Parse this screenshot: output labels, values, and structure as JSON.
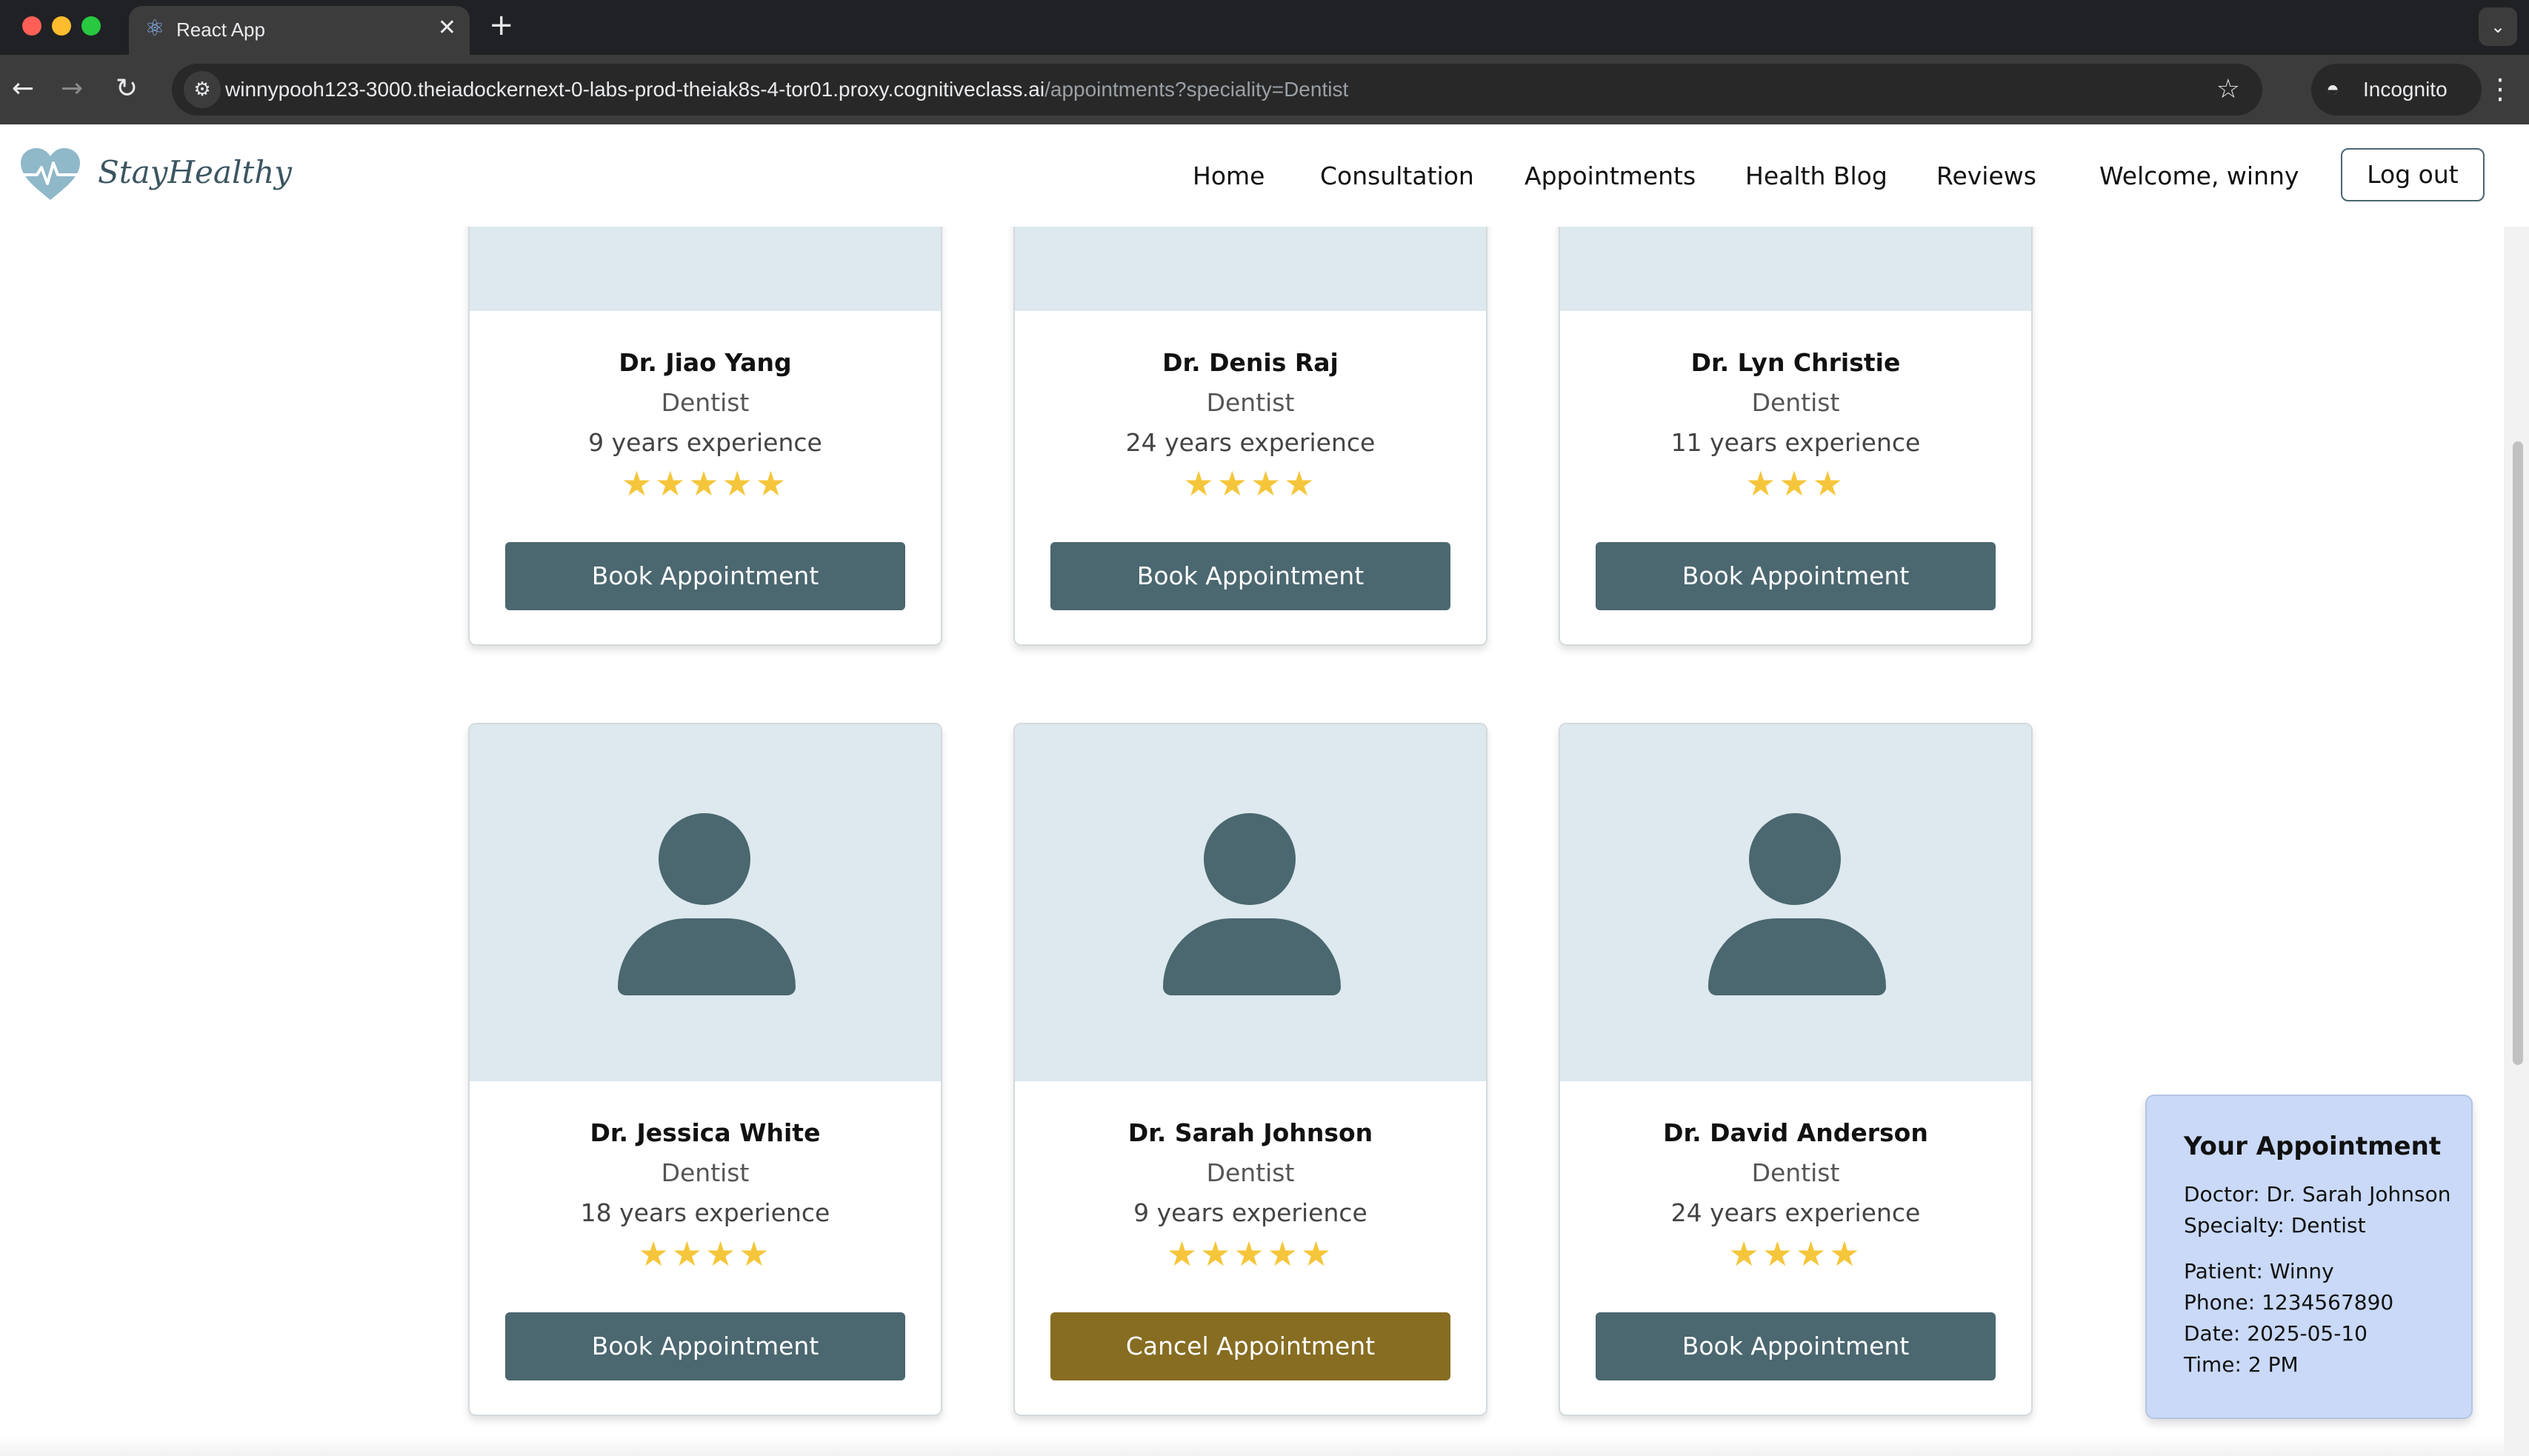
{
  "browser": {
    "tab_title": "React App",
    "url_host": "winnypooh123-3000.theiadockernext-0-labs-prod-theiak8s-4-tor01.proxy.cognitiveclass.ai",
    "url_path": "/appointments?speciality=Dentist",
    "incognito_label": "Incognito"
  },
  "header": {
    "brand": "StayHealthy",
    "nav": [
      "Home",
      "Consultation",
      "Appointments",
      "Health Blog",
      "Reviews"
    ],
    "welcome": "Welcome, winny",
    "logout": "Log out"
  },
  "doctors": [
    {
      "name": "Dr. Jiao Yang",
      "specialty": "Dentist",
      "experience": "9 years experience",
      "rating": 5,
      "stars": "★★★★★",
      "button": "Book Appointment"
    },
    {
      "name": "Dr. Denis Raj",
      "specialty": "Dentist",
      "experience": "24 years experience",
      "rating": 4,
      "stars": "★★★★",
      "button": "Book Appointment"
    },
    {
      "name": "Dr. Lyn Christie",
      "specialty": "Dentist",
      "experience": "11 years experience",
      "rating": 3,
      "stars": "★★★",
      "button": "Book Appointment"
    },
    {
      "name": "Dr. Jessica White",
      "specialty": "Dentist",
      "experience": "18 years experience",
      "rating": 4,
      "stars": "★★★★",
      "button": "Book Appointment"
    },
    {
      "name": "Dr. Sarah Johnson",
      "specialty": "Dentist",
      "experience": "9 years experience",
      "rating": 5,
      "stars": "★★★★★",
      "button": "Cancel Appointment"
    },
    {
      "name": "Dr. David Anderson",
      "specialty": "Dentist",
      "experience": "24 years experience",
      "rating": 4,
      "stars": "★★★★",
      "button": "Book Appointment"
    }
  ],
  "appointment": {
    "title": "Your Appointment",
    "doctor": "Doctor: Dr. Sarah Johnson",
    "specialty": "Specialty: Dentist",
    "patient": "Patient: Winny",
    "phone": "Phone: 1234567890",
    "date": "Date: 2025-05-10",
    "time": "Time: 2 PM"
  },
  "colors": {
    "primary_button": "#4b6770",
    "cancel_button": "#866d22",
    "star": "#f5c63b",
    "photo_bg": "#dde9ee",
    "summary_bg": "#c9d9f7"
  }
}
